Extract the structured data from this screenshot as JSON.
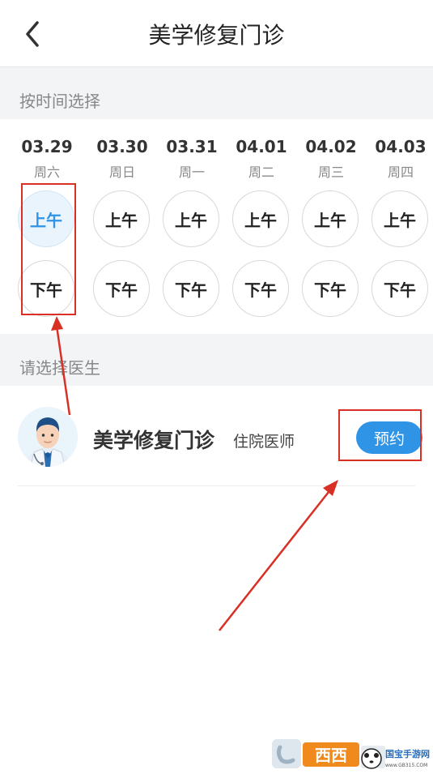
{
  "header": {
    "title": "美学修复门诊",
    "back_icon": "back-chevron-icon"
  },
  "time_section": {
    "label": "按时间选择"
  },
  "dates": [
    {
      "date": "03.29",
      "weekday": "周六",
      "am": "上午",
      "pm": "下午",
      "am_selected": true
    },
    {
      "date": "03.30",
      "weekday": "周日",
      "am": "上午",
      "pm": "下午",
      "am_selected": false
    },
    {
      "date": "03.31",
      "weekday": "周一",
      "am": "上午",
      "pm": "下午",
      "am_selected": false
    },
    {
      "date": "04.01",
      "weekday": "周二",
      "am": "上午",
      "pm": "下午",
      "am_selected": false
    },
    {
      "date": "04.02",
      "weekday": "周三",
      "am": "上午",
      "pm": "下午",
      "am_selected": false
    },
    {
      "date": "04.03",
      "weekday": "周四",
      "am": "上午",
      "pm": "下午",
      "am_selected": false
    }
  ],
  "doctor_section": {
    "label": "请选择医生"
  },
  "doctor": {
    "name": "美学修复门诊",
    "title": "住院医师",
    "book_label": "预约",
    "avatar_icon": "doctor-avatar-icon"
  },
  "colors": {
    "accent": "#2f93e6",
    "selected_bg": "#e9f4fd",
    "annotation": "#d93025",
    "section_bg": "#f3f4f6"
  },
  "watermark": {
    "text_main": "西西",
    "text_sub": "国宝手游网",
    "text_url": "www.GB315.COM"
  }
}
